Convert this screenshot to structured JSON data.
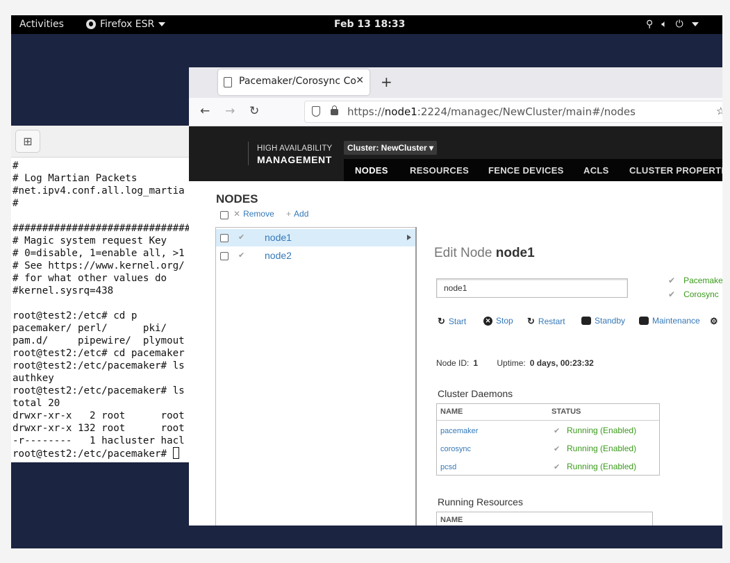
{
  "topbar": {
    "activities": "Activities",
    "app_name": "Firefox ESR",
    "clock": "Feb 13  18:33",
    "icons": [
      "network-icon",
      "volume-icon",
      "power-icon",
      "chevron-down-icon"
    ]
  },
  "terminal": {
    "lines": [
      "#",
      "# Log Martian Packets",
      "#net.ipv4.conf.all.log_martia",
      "#",
      "",
      "###############################",
      "# Magic system request Key",
      "# 0=disable, 1=enable all, >1",
      "# See https://www.kernel.org/",
      "# for what other values do",
      "#kernel.sysrq=438",
      "",
      "root@test2:/etc# cd p",
      "pacemaker/ perl/      pki/",
      "pam.d/     pipewire/  plymout",
      "root@test2:/etc# cd pacemaker",
      "root@test2:/etc/pacemaker# ls",
      "authkey",
      "root@test2:/etc/pacemaker# ls",
      "total 20",
      "drwxr-xr-x   2 root      root",
      "drwxr-xr-x 132 root      root",
      "-r--------   1 hacluster hacl"
    ],
    "prompt": "root@test2:/etc/pacemaker# "
  },
  "browser": {
    "tab_title": "Pacemaker/Corosync Con",
    "url_prefix": "https://",
    "url_host": "node1",
    "url_rest": ":2224/managec/NewCluster/main#/nodes"
  },
  "app": {
    "brand_line1": "HIGH AVAILABILITY",
    "brand_line2": "MANAGEMENT",
    "cluster_button": "Cluster: NewCluster",
    "menu": [
      "NODES",
      "RESOURCES",
      "FENCE DEVICES",
      "ACLS",
      "CLUSTER PROPERTIE"
    ],
    "active_menu": "NODES"
  },
  "nodes_panel": {
    "title": "NODES",
    "remove": "Remove",
    "add": "Add",
    "nodes": [
      {
        "name": "node1",
        "selected": true
      },
      {
        "name": "node2",
        "selected": false
      }
    ]
  },
  "detail": {
    "title_prefix": "Edit Node",
    "title_node": "node1",
    "name_value": "node1",
    "services": [
      "Pacemake",
      "Corosync"
    ],
    "actions": [
      "Start",
      "Stop",
      "Restart",
      "Standby",
      "Maintenance"
    ],
    "node_id_label": "Node ID:",
    "node_id": "1",
    "uptime_label": "Uptime:",
    "uptime": "0 days, 00:23:32",
    "daemons_title": "Cluster Daemons",
    "daemon_headers": [
      "NAME",
      "STATUS"
    ],
    "daemons": [
      {
        "name": "pacemaker",
        "status": "Running (Enabled)"
      },
      {
        "name": "corosync",
        "status": "Running (Enabled)"
      },
      {
        "name": "pcsd",
        "status": "Running (Enabled)"
      }
    ],
    "resources_title": "Running Resources",
    "resources_header": "NAME"
  },
  "colors": {
    "link": "#3478b8",
    "ok_green": "#3a9a1a",
    "header_bg": "#1c1c1c",
    "desktop_bg": "#1b2440"
  }
}
